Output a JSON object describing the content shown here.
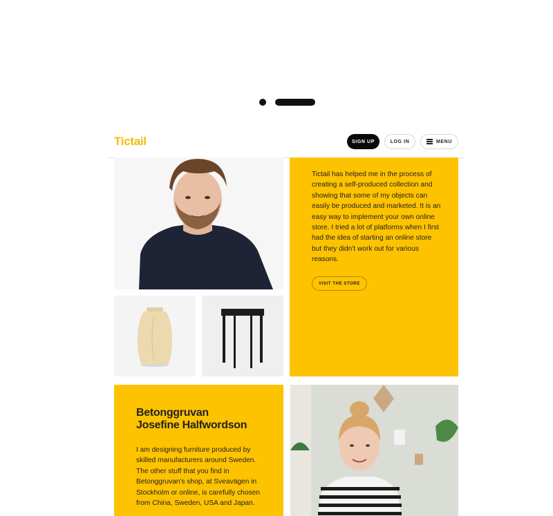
{
  "header": {
    "logo": "Tictail",
    "signup_label": "SIGN UP",
    "login_label": "LOG IN",
    "menu_label": "MENU"
  },
  "feature_1": {
    "quote": "Tictail has helped me in the process of creating a self-produced collection and showing that some of my objects can easily be produced and marketed. It is an easy way to implement your own online store. I tried a lot of platforms when I first had the idea of starting an online store but they didn't work out for various reasons.",
    "visit_label": "VISIT THE STORE"
  },
  "feature_2": {
    "store_name": "Betonggruvan",
    "owner_name": "Josefine Halfwordson",
    "bio": "I am designing furniture produced by skilled manufacturers around Sweden. The other stuff that you find in Betonggruvan's shop, at Sveavägen in Stockholm or online, is carefully chosen from China, Sweden, USA and Japan."
  },
  "colors": {
    "brand_yellow": "#fec300",
    "logo_yellow": "#f5bd00",
    "dark": "#0a0a0a"
  }
}
